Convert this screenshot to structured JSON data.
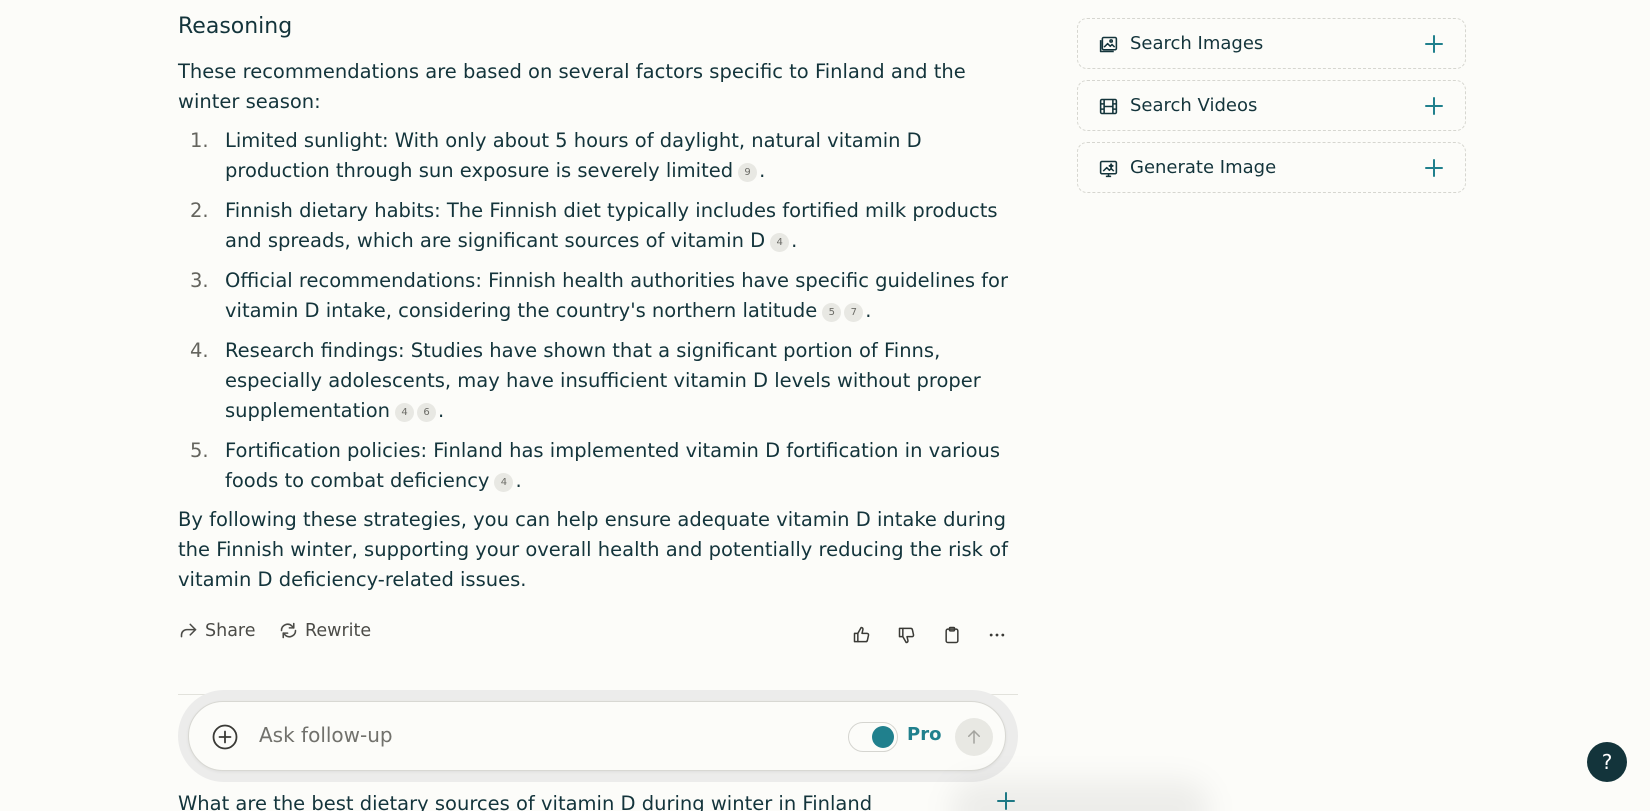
{
  "answer": {
    "heading": "Reasoning",
    "intro": "These recommendations are based on several factors specific to Finland and the winter season:",
    "items": [
      {
        "num": "1.",
        "text": "Limited sunlight: With only about 5 hours of daylight, natural vitamin D production through sun exposure is severely limited",
        "cites": [
          "9"
        ]
      },
      {
        "num": "2.",
        "text": "Finnish dietary habits: The Finnish diet typically includes fortified milk products and spreads, which are significant sources of vitamin D",
        "cites": [
          "4"
        ]
      },
      {
        "num": "3.",
        "text": "Official recommendations: Finnish health authorities have specific guidelines for vitamin D intake, considering the country's northern latitude",
        "cites": [
          "5",
          "7"
        ]
      },
      {
        "num": "4.",
        "text": "Research findings: Studies have shown that a significant portion of Finns, especially adolescents, may have insufficient vitamin D levels without proper supplementation",
        "cites": [
          "4",
          "6"
        ]
      },
      {
        "num": "5.",
        "text": "Fortification policies: Finland has implemented vitamin D fortification in various foods to combat deficiency",
        "cites": [
          "4"
        ]
      }
    ],
    "outro": "By following these strategies, you can help ensure adequate vitamin D intake during the Finnish winter, supporting your overall health and potentially reducing the risk of vitamin D deficiency-related issues.",
    "period": "."
  },
  "actions": {
    "share_label": "Share",
    "rewrite_label": "Rewrite",
    "icons": [
      "thumbs-up-icon",
      "thumbs-down-icon",
      "clipboard-icon",
      "more-icon"
    ]
  },
  "composer": {
    "placeholder": "Ask follow-up",
    "pro_label": "Pro",
    "pro_enabled": true
  },
  "related": {
    "first_question": "What are the best dietary sources of vitamin D during winter in Finland"
  },
  "sidebar": {
    "cards": [
      {
        "label": "Search Images",
        "icon": "image-icon"
      },
      {
        "label": "Search Videos",
        "icon": "video-icon"
      },
      {
        "label": "Generate Image",
        "icon": "generate-image-icon"
      }
    ]
  },
  "help": {
    "label": "?"
  },
  "colors": {
    "accent": "#20808d",
    "text": "#13343b",
    "background": "#fcfcf9"
  }
}
